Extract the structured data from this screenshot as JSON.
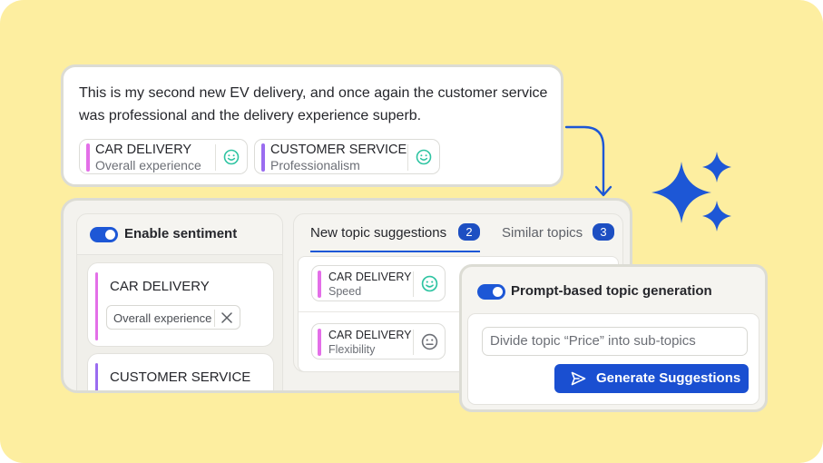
{
  "review": {
    "text": "This is my second new EV delivery, and once again the customer service was professional and the delivery experience superb.",
    "tags": [
      {
        "title": "CAR DELIVERY",
        "subtitle": "Overall experience",
        "accent": "#e36fe8",
        "sentiment": "positive"
      },
      {
        "title": "CUSTOMER SERVICE",
        "subtitle": "Professionalism",
        "accent": "#9a6cf0",
        "sentiment": "positive"
      }
    ]
  },
  "sentiment_panel": {
    "toggle_label": "Enable sentiment",
    "toggle_on": true,
    "topics": [
      {
        "title": "CAR DELIVERY",
        "accent": "#e36fe8",
        "subtopic": "Overall experience"
      },
      {
        "title": "CUSTOMER SERVICE",
        "accent": "#9a6cf0"
      }
    ]
  },
  "suggestions_panel": {
    "tabs": [
      {
        "label": "New topic suggestions",
        "count": "2",
        "active": true
      },
      {
        "label": "Similar topics",
        "count": "3",
        "active": false
      }
    ],
    "items": [
      {
        "title": "CAR DELIVERY",
        "subtitle": "Speed",
        "sentiment": "positive"
      },
      {
        "title": "CAR DELIVERY",
        "subtitle": "Flexibility",
        "sentiment": "neutral"
      }
    ]
  },
  "prompt_panel": {
    "toggle_label": "Prompt-based topic generation",
    "toggle_on": true,
    "input_value": "Divide topic “Price” into sub-topics",
    "button_label": "Generate Suggestions"
  },
  "colors": {
    "background": "#fdeea0",
    "accent_blue": "#1d57d6",
    "positive": "#2fc4a2",
    "neutral": "#6c6f76"
  },
  "icons": [
    "smile-icon",
    "neutral-face-icon",
    "close-icon",
    "send-icon",
    "sparkles-icon",
    "curved-arrow-icon"
  ]
}
